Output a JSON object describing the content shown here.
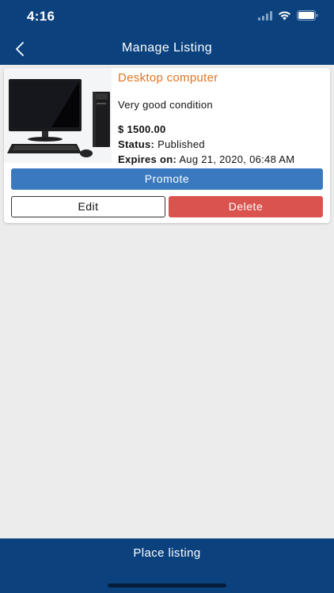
{
  "status_bar": {
    "time": "4:16",
    "icons": [
      "signal-icon",
      "wifi-icon",
      "battery-icon"
    ]
  },
  "nav": {
    "title": "Manage Listing",
    "back_icon": "chevron-left-icon"
  },
  "listing": {
    "image_icon": "desktop-computer-image",
    "title": "Desktop computer",
    "description": "Very good condition",
    "price": "$ 1500.00",
    "status_label": "Status:",
    "status_value": "Published",
    "expires_label": "Expires on:",
    "expires_value": "Aug 21, 2020, 06:48 AM"
  },
  "actions": {
    "promote": "Promote",
    "edit": "Edit",
    "delete": "Delete"
  },
  "footer": {
    "place_listing": "Place listing"
  },
  "colors": {
    "brand": "#0b427e",
    "title_accent": "#e2731f",
    "promote": "#3a79c0",
    "delete": "#d9534f",
    "background": "#ececec"
  }
}
